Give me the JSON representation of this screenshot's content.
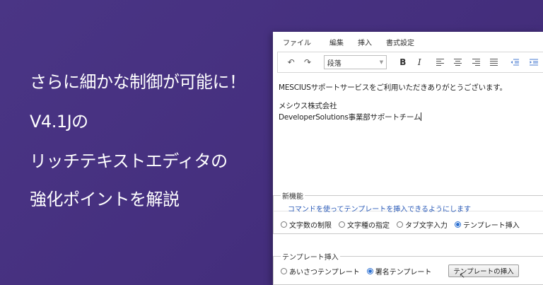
{
  "headline": {
    "line1": "さらに細かな制御が可能に！",
    "line2": "V4.1Jの",
    "line3": "リッチテキストエディタの",
    "line4": "強化ポイントを解説"
  },
  "menubar": {
    "file": "ファイル",
    "edit": "編集",
    "insert": "挿入",
    "format": "書式設定"
  },
  "toolbar": {
    "undo": "↶",
    "redo": "↷",
    "block_format": "段落",
    "bold": "B",
    "italic": "I"
  },
  "editor": {
    "line1": "MESCIUSサポートサービスをご利用いただきありがとうございます。",
    "line2": "メシウス株式会社",
    "line3": "DeveloperSolutions事業部サポートチーム"
  },
  "new_features": {
    "legend": "新機能",
    "description": "コマンドを使ってテンプレートを挿入できるようにします",
    "options": [
      {
        "label": "文字数の制限",
        "checked": false
      },
      {
        "label": "文字種の指定",
        "checked": false
      },
      {
        "label": "タブ文字入力",
        "checked": false
      },
      {
        "label": "テンプレート挿入",
        "checked": true
      }
    ]
  },
  "template_insert": {
    "legend": "テンプレート挿入",
    "options": [
      {
        "label": "あいさつテンプレート",
        "checked": false
      },
      {
        "label": "署名テンプレート",
        "checked": true
      }
    ],
    "button_label": "テンプレートの挿入"
  },
  "colors": {
    "background": "#4a3585",
    "accent": "#2b6fd1",
    "description_text": "#2b5bb8"
  }
}
